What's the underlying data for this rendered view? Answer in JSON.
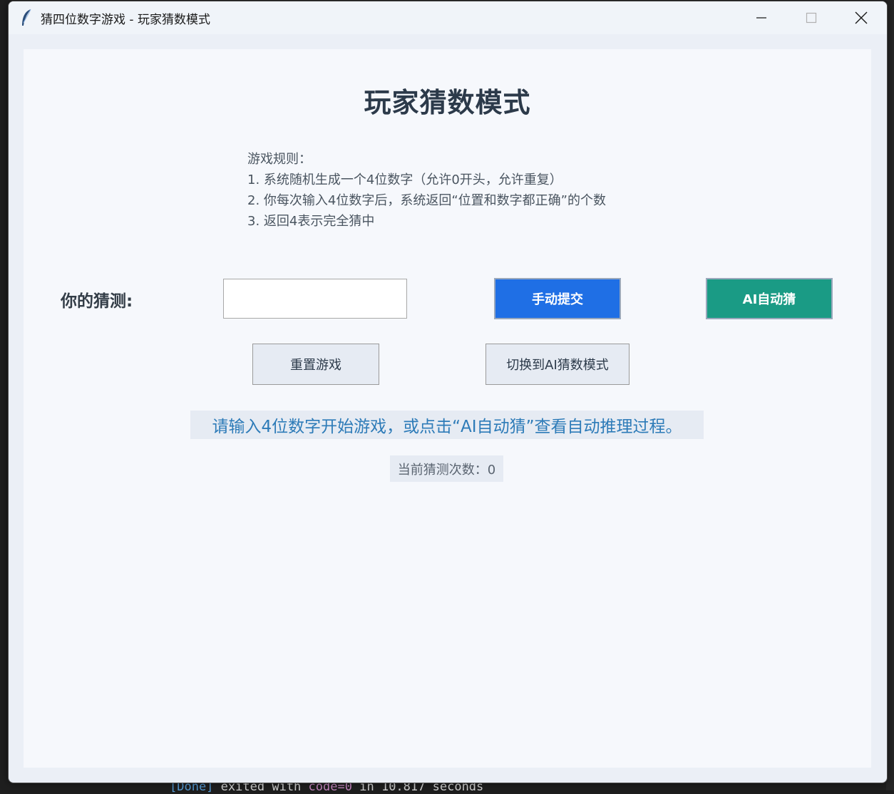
{
  "window": {
    "title": "猜四位数字游戏 - 玩家猜数模式"
  },
  "main": {
    "heading": "玩家猜数模式",
    "rules": [
      "游戏规则：",
      "1. 系统随机生成一个4位数字（允许0开头，允许重复）",
      "2. 你每次输入4位数字后，系统返回“位置和数字都正确”的个数",
      "3. 返回4表示完全猜中"
    ],
    "guess_label": "你的猜测:",
    "guess_value": "",
    "submit_label": "手动提交",
    "ai_guess_label": "AI自动猜",
    "reset_label": "重置游戏",
    "switch_label": "切换到AI猜数模式",
    "status_text": "请输入4位数字开始游戏，或点击“AI自动猜”查看自动推理过程。",
    "count_text": "当前猜测次数：0"
  },
  "background": {
    "code_line": [
      "[Done]",
      "exited",
      "with",
      "code=0",
      "in",
      "10.817",
      "seconds"
    ]
  },
  "colors": {
    "submit": "#1f6fe5",
    "ai_guess": "#1a9b85",
    "status_text": "#2d7bb8"
  }
}
